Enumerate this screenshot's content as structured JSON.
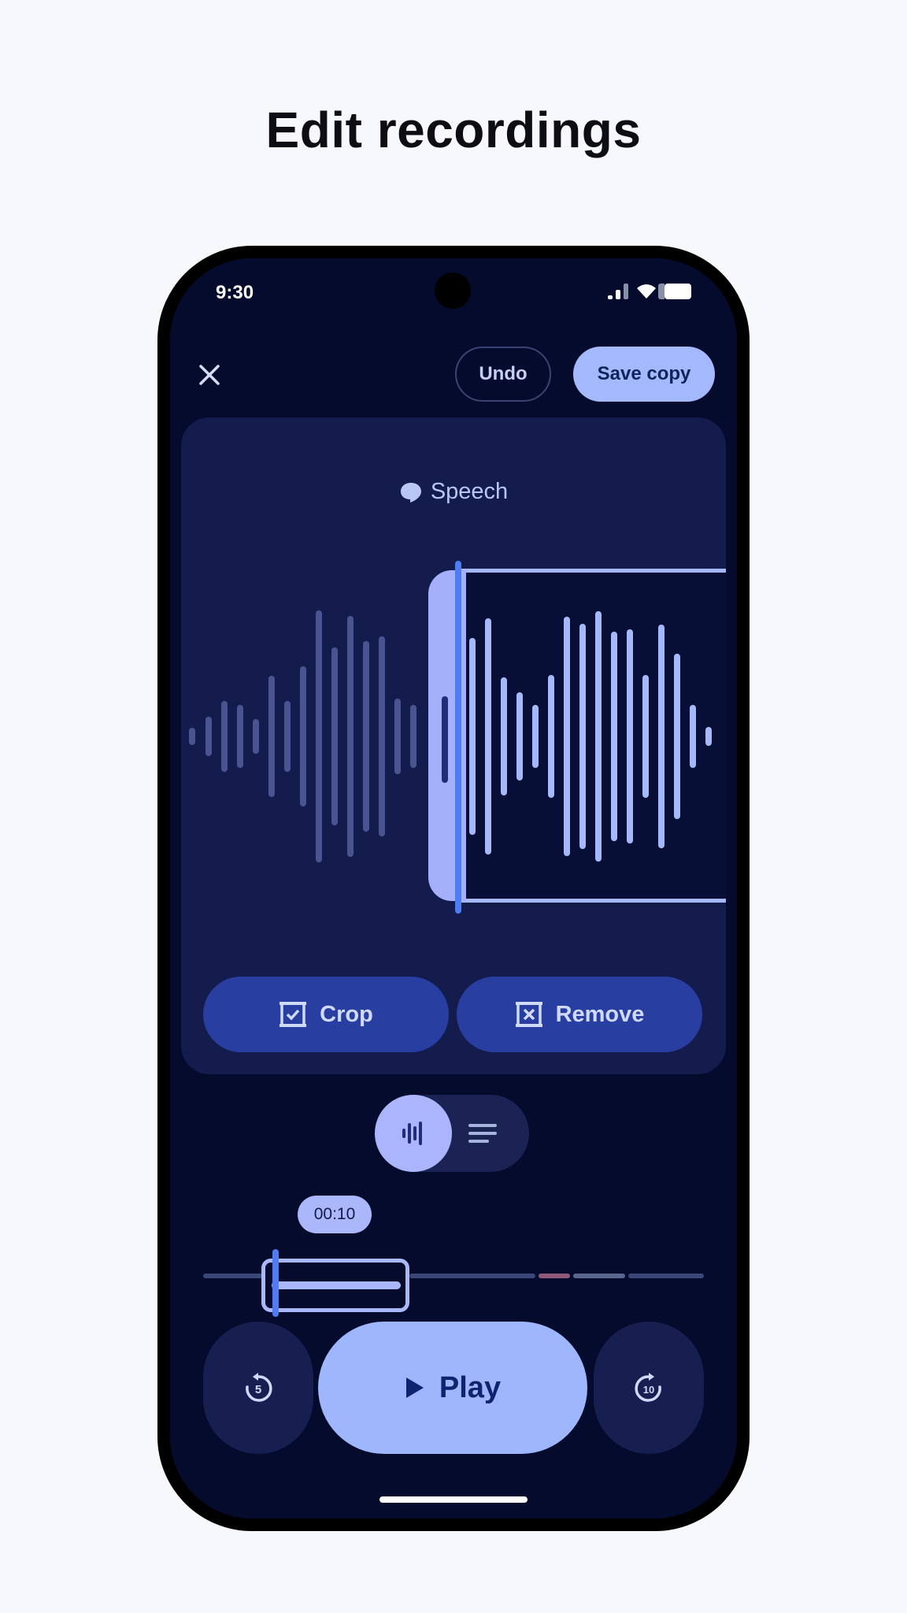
{
  "headline": "Edit recordings",
  "status_bar": {
    "time": "9:30",
    "icons": [
      "signal-icon",
      "wifi-icon",
      "battery-icon"
    ]
  },
  "toolbar": {
    "close_icon": "close-icon",
    "undo_label": "Undo",
    "save_label": "Save copy"
  },
  "editor": {
    "label": "Speech",
    "label_icon": "speech-bubble-icon",
    "crop_label": "Crop",
    "remove_label": "Remove"
  },
  "view_toggle": {
    "selected": "waveform",
    "options": [
      "waveform-icon",
      "transcript-icon"
    ]
  },
  "timeline": {
    "time_label": "00:10"
  },
  "playback": {
    "rewind_label": "5",
    "play_label": "Play",
    "forward_label": "10"
  },
  "colors": {
    "background": "#050b2c",
    "card": "#141c4d",
    "accent": "#a4b9fb",
    "cursor": "#4f7cf0",
    "button": "#283ea1"
  }
}
